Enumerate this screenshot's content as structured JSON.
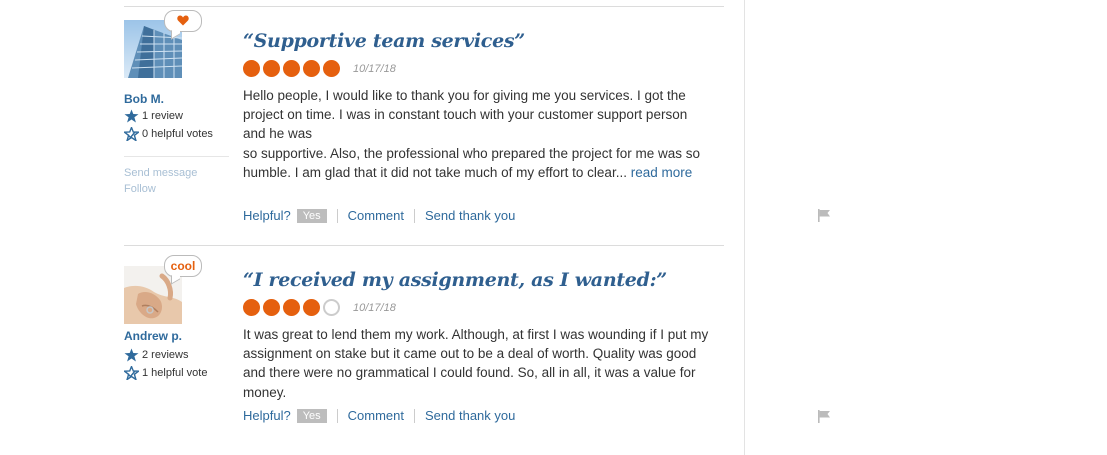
{
  "reviews": [
    {
      "badge": "",
      "badge_icon": "heart-icon",
      "user": {
        "name": "Bob M.",
        "reviews": "1 review",
        "votes": "0 helpful votes",
        "send_message": "Send message",
        "follow": "Follow"
      },
      "title": "“Supportive team services”",
      "rating": 5,
      "date": "10/17/18",
      "body": "Hello people, I would like to thank you for giving me you services. I got the project on time. I was in constant touch with your customer support person and he was\nso supportive. Also, the professional who prepared the project for me was so humble. I am glad that it did not take much of my effort to clear... ",
      "read_more": "read more",
      "helpful": "Helpful?",
      "yes": "Yes",
      "comment": "Comment",
      "thank": "Send thank you"
    },
    {
      "badge": "cool",
      "badge_icon": "",
      "user": {
        "name": "Andrew p.",
        "reviews": "2 reviews",
        "votes": "1 helpful vote"
      },
      "title": "“I received my assignment, as I wanted:”",
      "rating": 4,
      "date": "10/17/18",
      "body": "It was great to lend them my work. Although, at first I was wounding if I put my assignment on stake but it came out to be a deal of worth. Quality was good and there were no grammatical I could found. So, all in all, it was a value for money.",
      "helpful": "Helpful?",
      "yes": "Yes",
      "comment": "Comment",
      "thank": "Send thank you"
    }
  ],
  "colors": {
    "accent": "#e5600f",
    "link": "#2f6a9c",
    "title": "#2f5f8f"
  }
}
